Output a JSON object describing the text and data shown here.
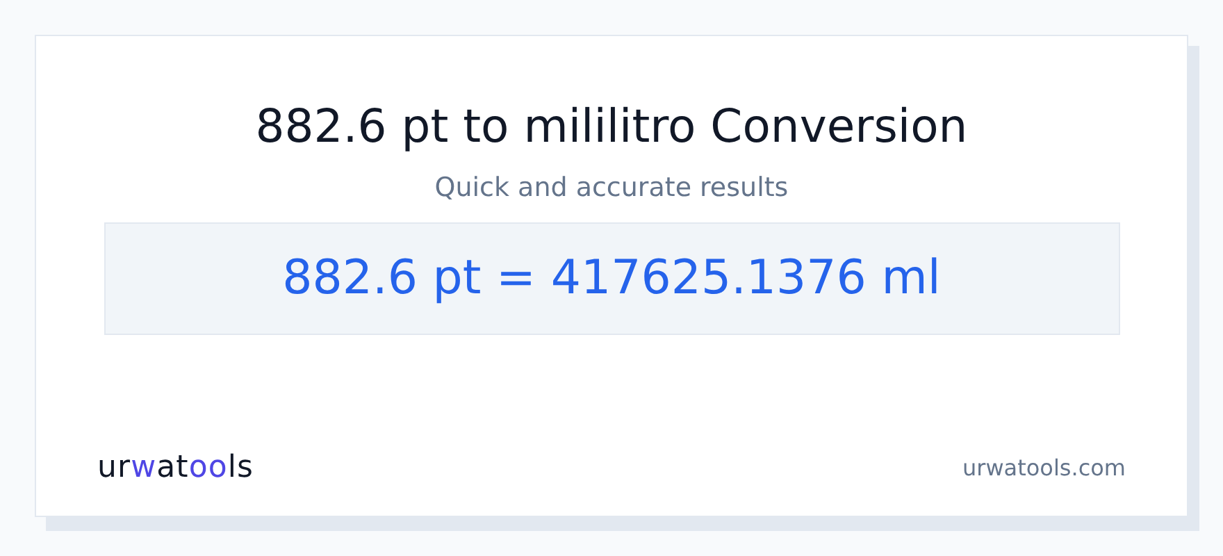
{
  "title": "882.6 pt to mililitro Conversion",
  "subtitle": "Quick and accurate results",
  "result": "882.6 pt = 417625.1376 ml",
  "logo": [
    {
      "text": "ur",
      "accent": false
    },
    {
      "text": "w",
      "accent": true
    },
    {
      "text": "at",
      "accent": false
    },
    {
      "text": "oo",
      "accent": true
    },
    {
      "text": "ls",
      "accent": false
    }
  ],
  "site": "urwatools.com"
}
